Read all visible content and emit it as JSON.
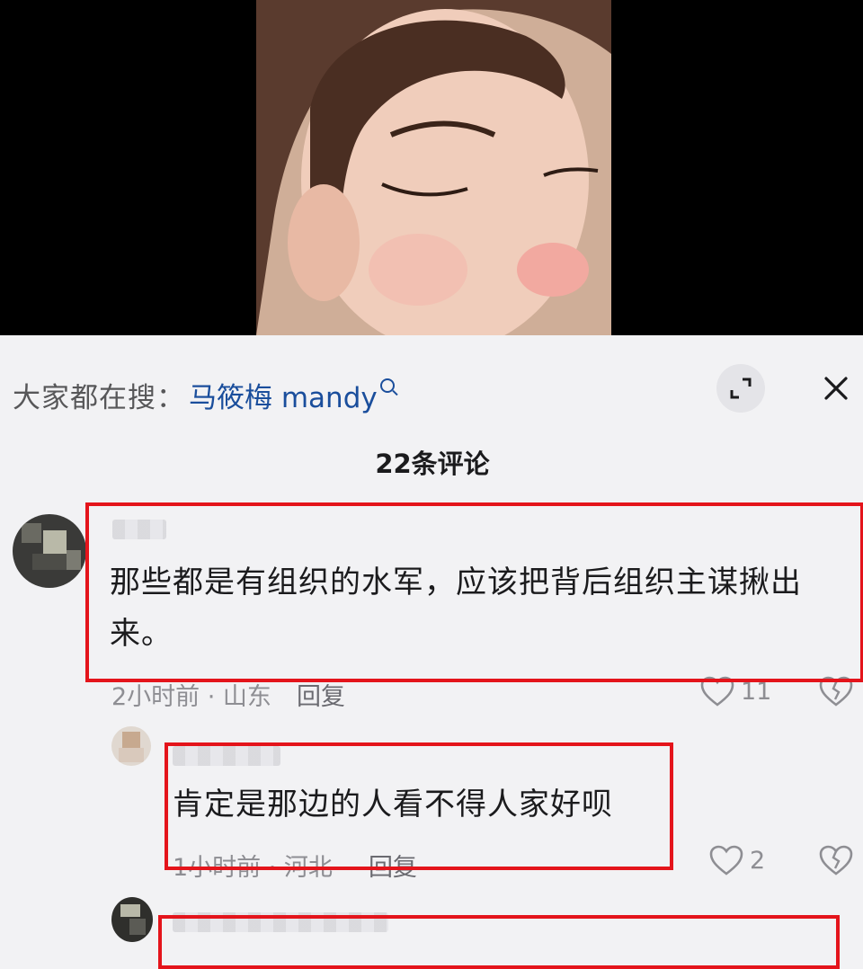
{
  "video": {
    "alt": ""
  },
  "panel": {
    "search_prefix": "大家都在搜：",
    "search_term": "马筱梅 mandy",
    "comment_count": "22条评论"
  },
  "comments": [
    {
      "text_line1": "那些都是有组织的水军，应该把背后组织主谋揪出",
      "text_line2": "来。",
      "meta": "2小时前 · 山东",
      "reply_label": "回复",
      "likes": "11"
    },
    {
      "text": "肯定是那边的人看不得人家好呗",
      "meta": "1小时前 · 河北",
      "reply_label": "回复",
      "likes": "2"
    }
  ],
  "colors": {
    "highlight_box": "#e4141b",
    "search_link": "#1a4e9c",
    "background": "#f2f2f4"
  },
  "icons": [
    "search-icon",
    "expand-icon",
    "close-icon",
    "heart-icon",
    "dislike-heart-icon"
  ]
}
